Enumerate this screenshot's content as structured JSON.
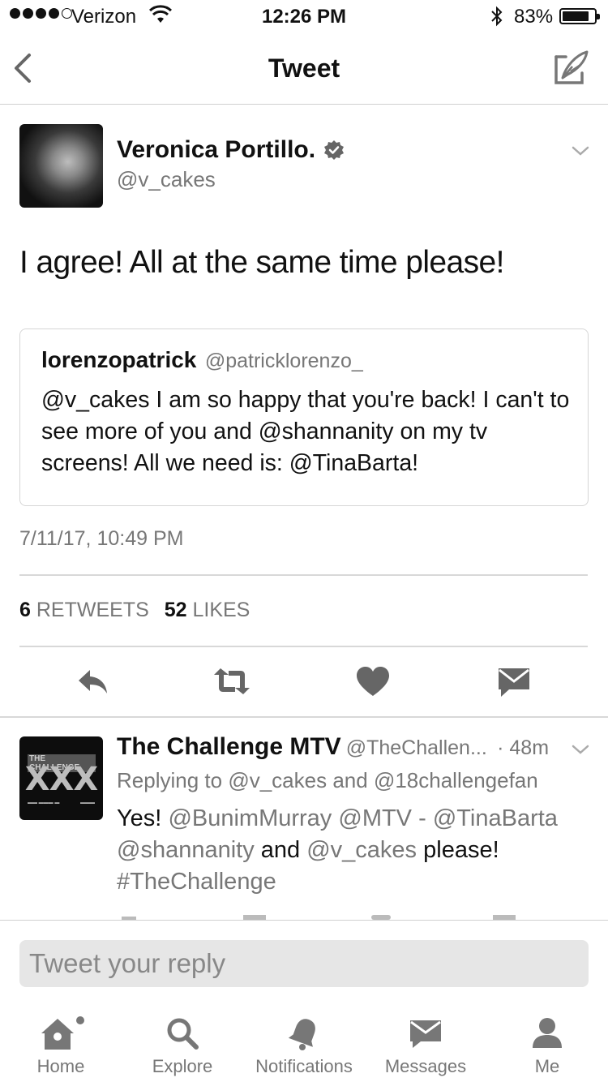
{
  "status_bar": {
    "carrier": "Verizon",
    "time": "12:26 PM",
    "battery_percent": "83%",
    "battery_level": 0.83,
    "signal_bars": 4,
    "signal_max": 5
  },
  "nav": {
    "title": "Tweet",
    "back_icon": "chevron-left-icon",
    "compose_icon": "compose-quill-icon"
  },
  "tweet": {
    "author_name": "Veronica Portillo.",
    "author_handle": "@v_cakes",
    "verified": true,
    "text": "I agree!  All at the same time please!",
    "quoted": {
      "name": "lorenzopatrick",
      "handle": "@patricklorenzo_",
      "text": "@v_cakes I am so happy that you're back! I can't to see more of you and @shannanity on my tv screens! All we need is: @TinaBarta!"
    },
    "timestamp": "7/11/17, 10:49 PM",
    "retweets_count": "6",
    "retweets_label": "RETWEETS",
    "likes_count": "52",
    "likes_label": "LIKES",
    "actions": [
      "reply-icon",
      "retweet-icon",
      "heart-icon",
      "message-icon"
    ]
  },
  "reply": {
    "author_name": "The Challenge MTV",
    "author_handle": "@TheChallen...",
    "time": "· 48m",
    "replying_to_prefix": "Replying to",
    "replying_to_1": "@v_cakes",
    "replying_to_and": "and",
    "replying_to_2": "@18challengefan",
    "text_part1": "Yes!",
    "mention1": "@BunimMurray",
    "mention2": "@MTV",
    "dash": "-",
    "mention3": "@TinaBarta",
    "mention4": "@shannanity",
    "and": "and",
    "mention5": "@v_cakes",
    "please": "please!",
    "hashtag": "#TheChallenge",
    "avatar_show": "THE CHALLENGE",
    "avatar_title": "XXX"
  },
  "reply_bar": {
    "placeholder": "Tweet your reply"
  },
  "tabs": [
    {
      "label": "Home",
      "icon": "home-icon"
    },
    {
      "label": "Explore",
      "icon": "search-icon"
    },
    {
      "label": "Notifications",
      "icon": "bell-icon"
    },
    {
      "label": "Messages",
      "icon": "envelope-icon"
    },
    {
      "label": "Me",
      "icon": "person-icon"
    }
  ]
}
